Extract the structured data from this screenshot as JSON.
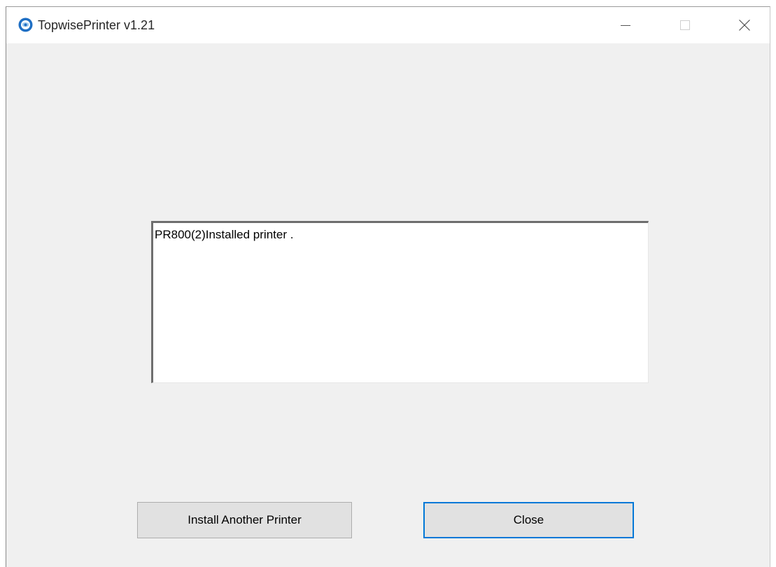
{
  "window": {
    "title": "TopwisePrinter v1.21",
    "accent_color": "#0078d7",
    "icons": {
      "app": "app-globe-icon",
      "minimize": "minimize-icon",
      "maximize": "maximize-icon",
      "close": "close-icon"
    }
  },
  "log": {
    "text": "PR800(2)Installed printer ."
  },
  "buttons": {
    "install_another": "Install Another Printer",
    "close": "Close"
  }
}
